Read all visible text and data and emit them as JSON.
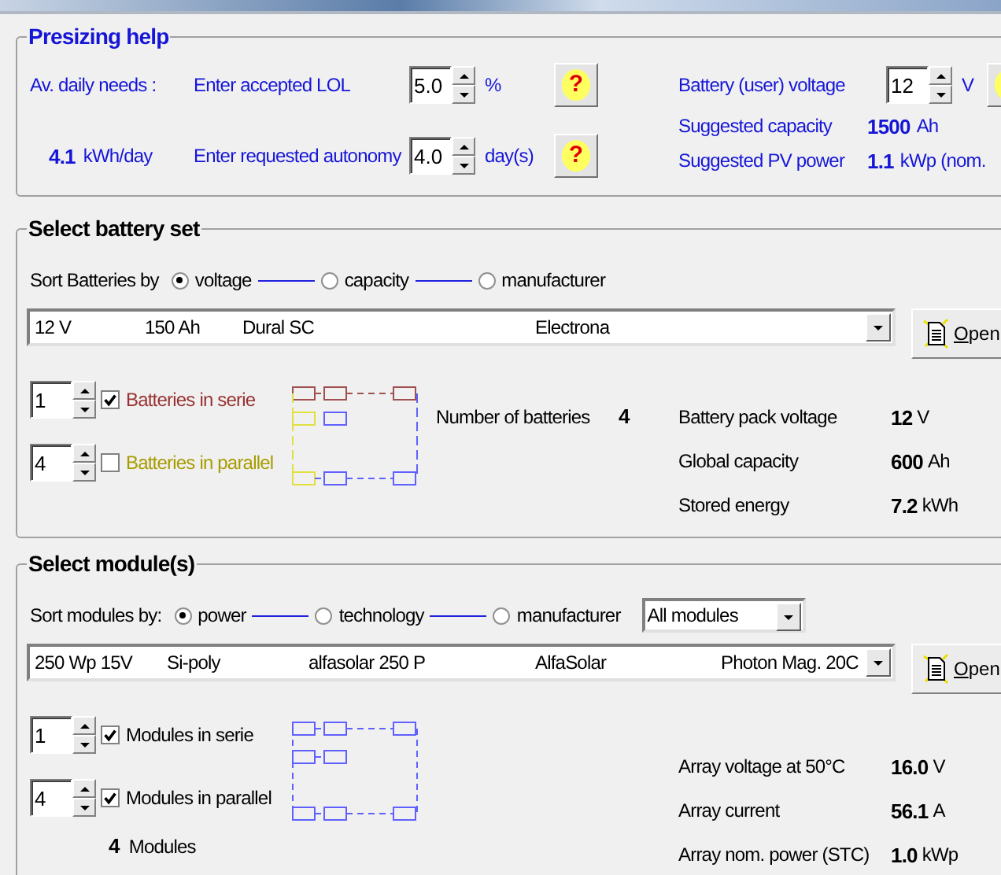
{
  "presizing": {
    "title": "Presizing help",
    "daily_label": "Av. daily needs :",
    "daily_value": "4.1",
    "daily_unit": "kWh/day",
    "lol": {
      "label": "Enter accepted LOL",
      "value": "5.0",
      "unit": "%",
      "help": "?"
    },
    "autonomy": {
      "label": "Enter requested autonomy",
      "value": "4.0",
      "unit": "day(s)",
      "help": "?"
    },
    "voltage": {
      "label": "Battery (user) voltage",
      "value": "12",
      "unit": "V"
    },
    "suggested": [
      {
        "label": "Suggested capacity",
        "value": "1500",
        "unit": "Ah"
      },
      {
        "label": "Suggested PV power",
        "value": "1.1",
        "unit": "kWp (nom."
      }
    ]
  },
  "battery": {
    "title": "Select battery set",
    "sort_label": "Sort Batteries by",
    "sort_options": [
      {
        "label": "voltage",
        "selected": true
      },
      {
        "label": "capacity",
        "selected": false
      },
      {
        "label": "manufacturer",
        "selected": false
      }
    ],
    "combo": [
      "12 V",
      "150 Ah",
      "Dural SC",
      "Electrona"
    ],
    "open_button": "Open",
    "rows": [
      {
        "value": "1",
        "checked": true,
        "label": "Batteries in serie",
        "color": "#993333"
      },
      {
        "value": "4",
        "checked": false,
        "label": "Batteries in parallel",
        "color": "#a89c00"
      }
    ],
    "number_label": "Number of batteries",
    "number_value": "4",
    "stats": [
      {
        "label": "Battery pack voltage",
        "value": "12",
        "unit": "V"
      },
      {
        "label": "Global capacity",
        "value": "600",
        "unit": "Ah"
      },
      {
        "label": "Stored energy",
        "value": "7.2",
        "unit": "kWh"
      }
    ]
  },
  "modules": {
    "title": "Select module(s)",
    "sort_label": "Sort modules by:",
    "sort_options": [
      {
        "label": "power",
        "selected": true
      },
      {
        "label": "technology",
        "selected": false
      },
      {
        "label": "manufacturer",
        "selected": false
      }
    ],
    "filter": "All modules",
    "combo": [
      "250 Wp 15V",
      "Si-poly",
      "alfasolar 250 P",
      "AlfaSolar",
      "Photon Mag. 20C"
    ],
    "open_button": "Open",
    "rows": [
      {
        "value": "1",
        "checked": true,
        "label": "Modules in serie",
        "color": "#000000"
      },
      {
        "value": "4",
        "checked": true,
        "label": "Modules in parallel",
        "color": "#000000"
      }
    ],
    "count_value": "4",
    "count_label": "Modules",
    "stats": [
      {
        "label": "Array voltage at 50°C",
        "value": "16.0",
        "unit": "V"
      },
      {
        "label": "Array current",
        "value": "56.1",
        "unit": "A"
      },
      {
        "label": "Array nom. power (STC)",
        "value": "1.0",
        "unit": "kWp"
      }
    ]
  }
}
